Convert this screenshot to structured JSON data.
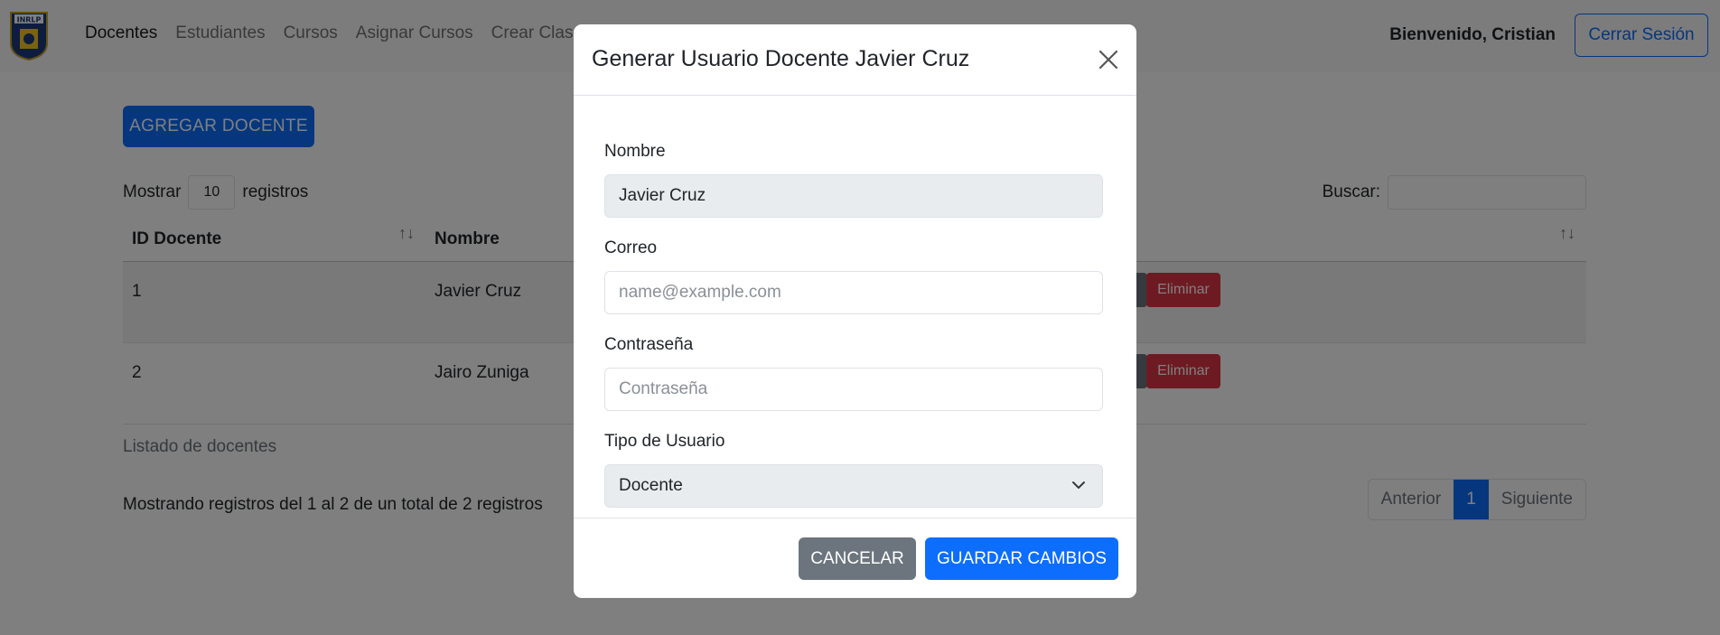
{
  "navbar": {
    "logo_alt": "INRLP",
    "links": [
      {
        "label": "Docentes"
      },
      {
        "label": "Estudiantes"
      },
      {
        "label": "Cursos"
      },
      {
        "label": "Asignar Cursos"
      },
      {
        "label": "Crear Clas"
      }
    ],
    "welcome": "Bienvenido, Cristian",
    "logout": "Cerrar Sesión"
  },
  "page": {
    "add_button": "AGREGAR DOCENTE",
    "length": {
      "prefix": "Mostrar",
      "value": "10",
      "suffix": "registros"
    },
    "search_label": "Buscar:",
    "columns": [
      "ID Docente",
      "Nombre"
    ],
    "rows": [
      {
        "id": "1",
        "nombre": "Javier Cruz",
        "delete": "Eliminar"
      },
      {
        "id": "2",
        "nombre": "Jairo Zuniga",
        "delete": "Eliminar"
      }
    ],
    "caption": "Listado de docentes",
    "info": "Mostrando registros del 1 al 2 de un total de 2 registros",
    "pagination": {
      "prev": "Anterior",
      "current": "1",
      "next": "Siguiente"
    }
  },
  "modal": {
    "title": "Generar Usuario Docente Javier Cruz",
    "fields": {
      "nombre": {
        "label": "Nombre",
        "value": "Javier Cruz"
      },
      "correo": {
        "label": "Correo",
        "placeholder": "name@example.com"
      },
      "contrasena": {
        "label": "Contraseña",
        "placeholder": "Contraseña"
      },
      "tipo": {
        "label": "Tipo de Usuario",
        "value": "Docente"
      }
    },
    "cancel": "CANCELAR",
    "save": "GUARDAR CAMBIOS"
  },
  "colors": {
    "primary": "#0d6efd",
    "danger": "#dc3545",
    "secondary": "#6c757d"
  }
}
